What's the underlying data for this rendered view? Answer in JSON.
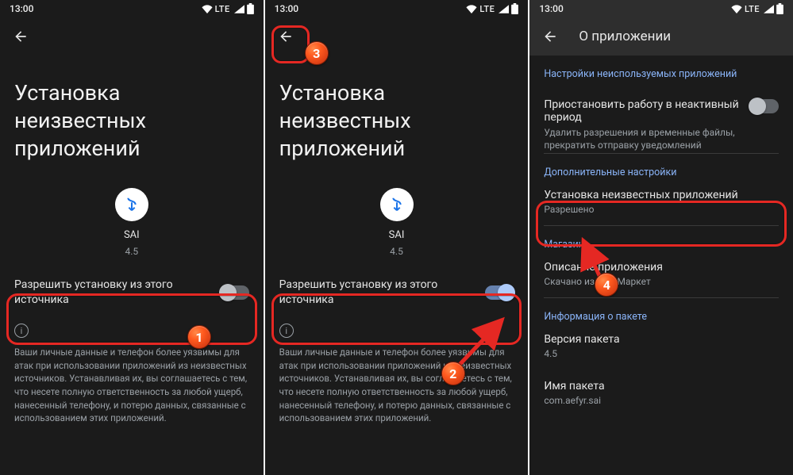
{
  "status": {
    "time": "13:00",
    "lte": "LTE"
  },
  "panel1": {
    "title": "Установка неизвестных приложений",
    "app": {
      "name": "SAI",
      "version": "4.5"
    },
    "setting_label": "Разрешить установку из этого источника",
    "toggle_on": false,
    "disclaimer": "Ваши личные данные и телефон более уязвимы для атак при использовании приложений из неизвестных источников. Устанавливая их, вы соглашаетесь с тем, что несете полную ответственность за любой ущерб, нанесенный телефону, и потерю данных, связанные с использованием этих приложений."
  },
  "panel2": {
    "title": "Установка неизвестных приложений",
    "app": {
      "name": "SAI",
      "version": "4.5"
    },
    "setting_label": "Разрешить установку из этого источника",
    "toggle_on": true,
    "disclaimer": "Ваши личные данные и телефон более уязвимы для атак при использовании приложений из неизвестных источников. Устанавливая их, вы соглашаетесь с тем, что несете полную ответственность за любой ущерб, нанесенный телефону, и потерю данных, связанные с использованием этих приложений."
  },
  "panel3": {
    "toolbar_title": "О приложении",
    "unused_section": "Настройки неиспользуемых приложений",
    "pause": {
      "title": "Приостановить работу в неактивный период",
      "sub": "Удалить разрешения и временные файлы, прекратить отправку уведомлений"
    },
    "extra_section": "Дополнительные настройки",
    "install_unknown": {
      "title": "Установка неизвестных приложений",
      "sub": "Разрешено"
    },
    "store_section": "Магазин",
    "app_desc": {
      "title": "Описание приложения",
      "sub": "Скачано из Play Маркет"
    },
    "pkg_info_section": "Информация о пакете",
    "pkg_version": {
      "title": "Версия пакета",
      "sub": "4.5"
    },
    "pkg_name": {
      "title": "Имя пакета",
      "sub": "com.aefyr.sai"
    }
  },
  "badges": {
    "b1": "1",
    "b2": "2",
    "b3": "3",
    "b4": "4"
  }
}
